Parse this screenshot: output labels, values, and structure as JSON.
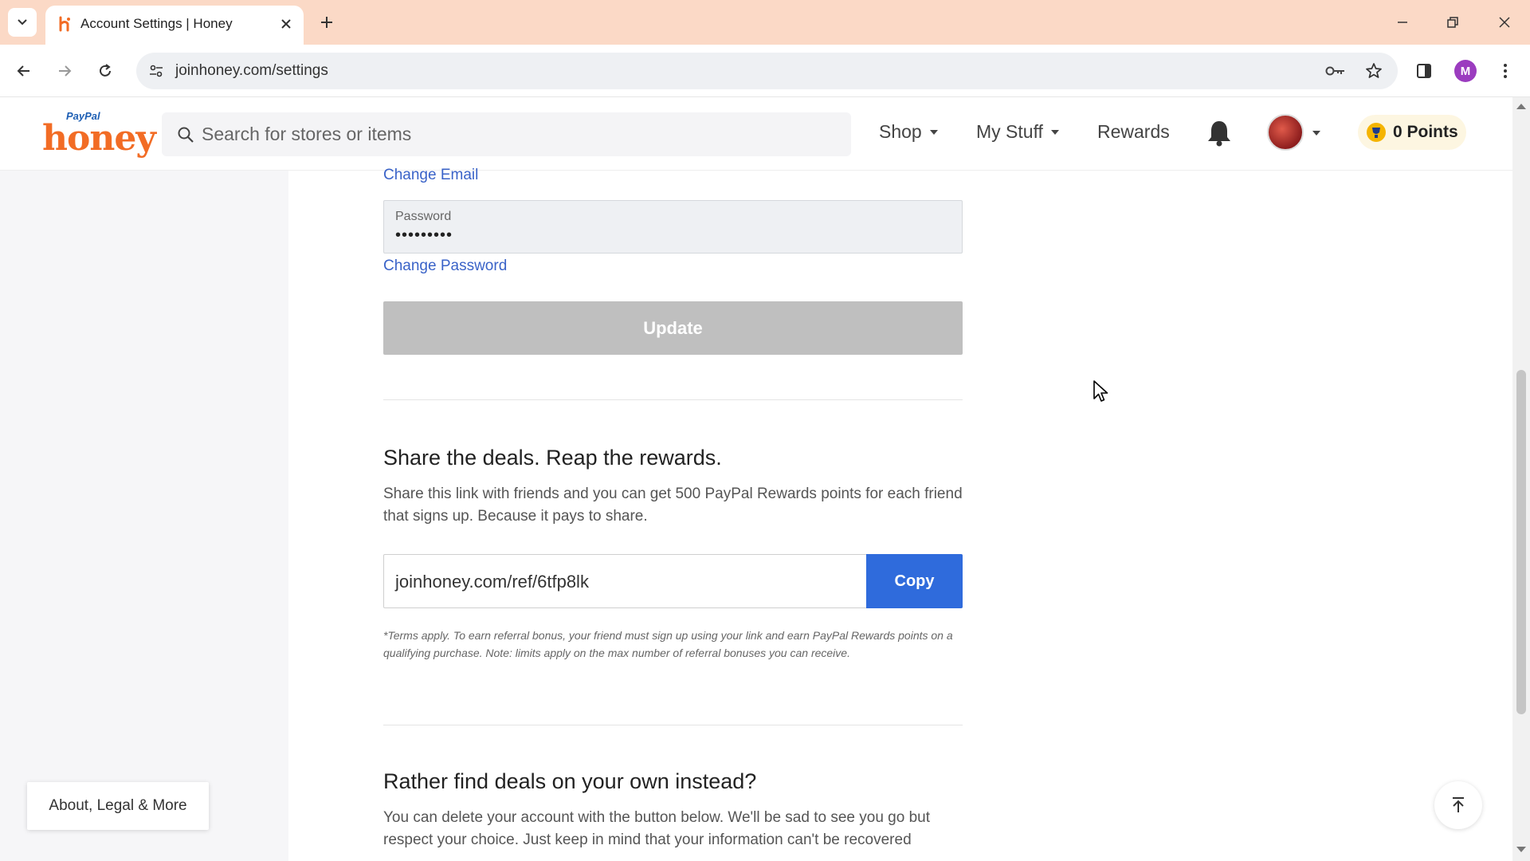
{
  "browser": {
    "tab_title": "Account Settings | Honey",
    "url": "joinhoney.com/settings",
    "profile_initial": "M"
  },
  "header": {
    "logo_paypal": "PayPal",
    "logo_honey": "honey",
    "search_placeholder": "Search for stores or items",
    "nav": {
      "shop": "Shop",
      "my_stuff": "My Stuff",
      "rewards": "Rewards"
    },
    "points": "0 Points"
  },
  "account": {
    "change_email": "Change Email",
    "password_label": "Password",
    "password_value": "•••••••••",
    "change_password": "Change Password",
    "update_label": "Update"
  },
  "referral": {
    "heading": "Share the deals. Reap the rewards.",
    "description": "Share this link with friends and you can get 500 PayPal Rewards points for each friend that signs up. Because it pays to share.",
    "link": "joinhoney.com/ref/6tfp8lk",
    "copy_label": "Copy",
    "terms": "*Terms apply. To earn referral bonus, your friend must sign up using your link and earn PayPal Rewards points on a qualifying purchase. Note: limits apply on the max number of referral bonuses you can receive."
  },
  "delete_account": {
    "heading": "Rather find deals on your own instead?",
    "description": "You can delete your account with the button below. We'll be sad to see you go but respect your choice. Just keep in mind that your information can't be recovered"
  },
  "footer": {
    "about_label": "About, Legal & More"
  },
  "colors": {
    "tabbar": "#fbd9c6",
    "brand_orange": "#f26c25",
    "link_blue": "#3a63c8",
    "copy_button": "#2f6bdc",
    "update_disabled": "#bfbfbf"
  }
}
